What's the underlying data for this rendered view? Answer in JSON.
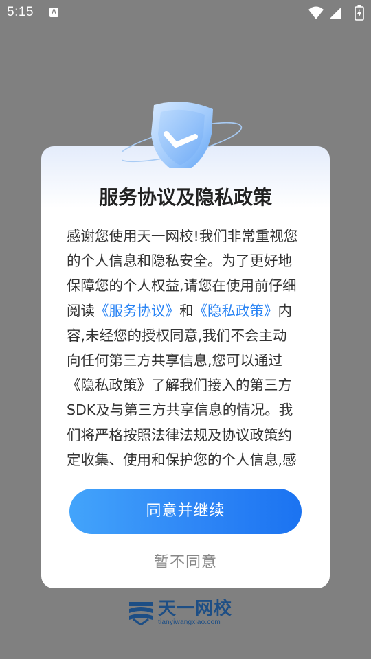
{
  "status_bar": {
    "time": "5:15",
    "notification_icon": "A",
    "icons": [
      "wifi-icon",
      "signal-icon",
      "battery-icon"
    ]
  },
  "dialog": {
    "title": "服务协议及隐私政策",
    "body_lines": [
      [
        {
          "text": "感谢您使用天一网校!我们非常重视您"
        }
      ],
      [
        {
          "text": "的个人信息和隐私安全。为了更好地"
        }
      ],
      [
        {
          "text": "保障您的个人权益,请您在使用前仔细"
        }
      ],
      [
        {
          "text": "阅读"
        },
        {
          "text": "《服务协议》",
          "link": true
        },
        {
          "text": "和"
        },
        {
          "text": "《隐私政策》",
          "link": true
        },
        {
          "text": "内"
        }
      ],
      [
        {
          "text": "容,未经您的授权同意,我们不会主动"
        }
      ],
      [
        {
          "text": "向任何第三方共享信息,您可以通过"
        }
      ],
      [
        {
          "text": "《隐私政策》了解我们接入的第三方"
        }
      ],
      [
        {
          "text": "SDK及与第三方共享信息的情况。我"
        }
      ],
      [
        {
          "text": "们将严格按照法律法规及协议政策约"
        }
      ],
      [
        {
          "text": "定收集、使用和保护您的个人信息,感"
        }
      ]
    ],
    "agree_label": "同意并继续",
    "disagree_label": "暂不同意"
  },
  "brand": {
    "name": "天一网校",
    "url": "tianyiwangxiao.com"
  },
  "colors": {
    "accent": "#2a84f4",
    "button_start": "#43a4fb",
    "button_end": "#1b73f1",
    "brand": "#1d4e85",
    "overlay": "#808080"
  }
}
